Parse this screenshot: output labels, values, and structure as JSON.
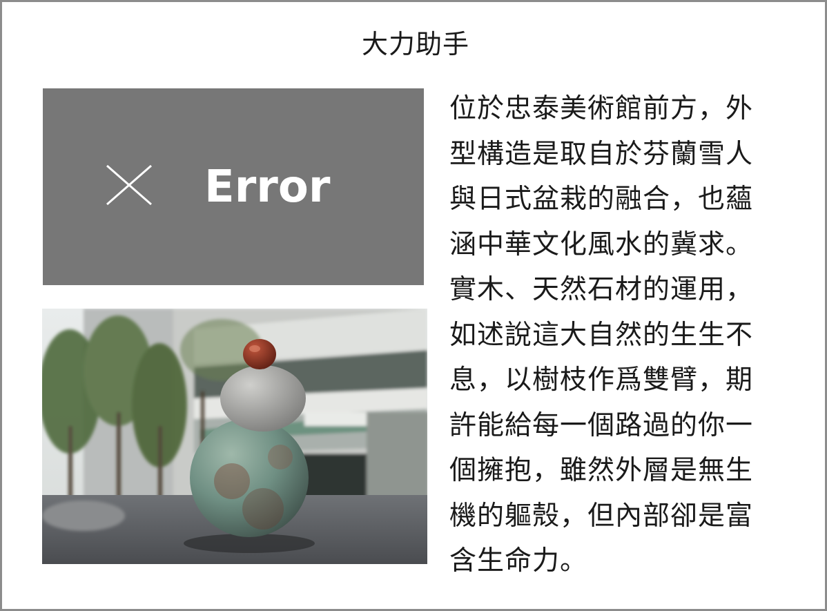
{
  "page": {
    "title": "大力助手",
    "error_label": "Error",
    "body_lines": [
      "位於忠泰美術館前方，外",
      "型構造是取自於芬蘭雪人",
      "與日式盆栽的融合，也蘊",
      "涵中華文化風水的冀求。",
      "實木、天然石材的運用，",
      "如述說這大自然的生生不",
      "息，以樹枝作爲雙臂，期",
      "許能給每一個路過的你一",
      "個擁抱，雖然外層是無生",
      "機的軀殼，但內部卻是富",
      "含生命力。"
    ]
  },
  "colors": {
    "border": "#8c8c8c",
    "error_box": "#777777",
    "error_text": "#ffffff",
    "text": "#1a1a1a"
  },
  "icons": {
    "error": "close-icon",
    "photo": "sculpture-photo"
  }
}
